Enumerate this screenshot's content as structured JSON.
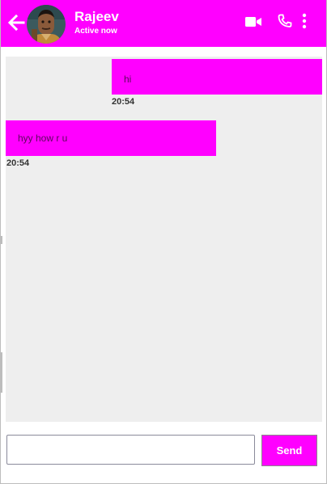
{
  "header": {
    "contact_name": "Rajeev",
    "status": "Active now",
    "icons": {
      "back": "arrow-left-icon",
      "avatar": "avatar",
      "video": "video-camera-icon",
      "call": "phone-icon",
      "more": "more-vertical-icon"
    }
  },
  "messages": [
    {
      "direction": "outgoing",
      "text": "hi",
      "time": "20:54"
    },
    {
      "direction": "incoming",
      "text": "hyy how r u",
      "time": "20:54"
    }
  ],
  "composer": {
    "input_value": "",
    "input_placeholder": "",
    "send_label": "Send"
  },
  "colors": {
    "accent": "#ff00ff",
    "chat_background": "#eeeeee",
    "header_text": "#ffffff"
  }
}
